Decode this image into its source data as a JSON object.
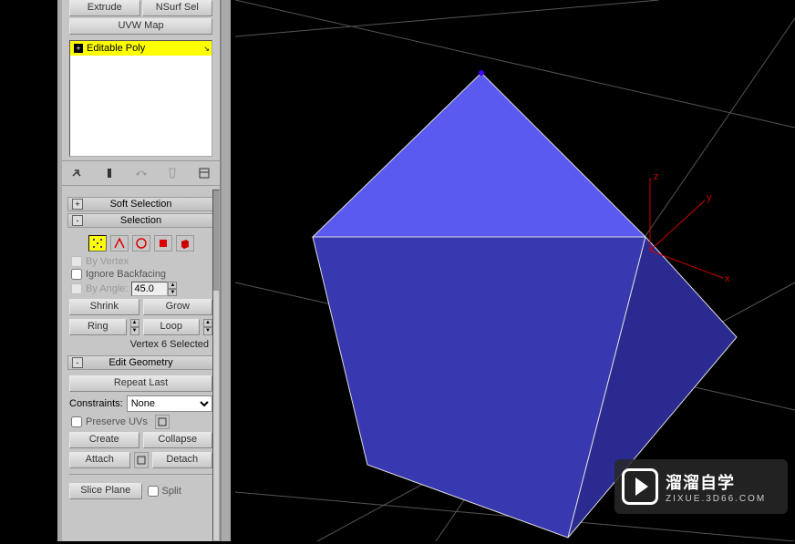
{
  "top_buttons": {
    "extrude": "Extrude",
    "nsurf": "NSurf Sel",
    "uvw": "UVW Map"
  },
  "modifier": {
    "item": "Editable Poly"
  },
  "rollouts": {
    "soft_selection": "Soft Selection",
    "selection": "Selection",
    "edit_geometry": "Edit Geometry"
  },
  "selection": {
    "by_vertex": "By Vertex",
    "ignore_backfacing": "Ignore Backfacing",
    "by_angle": "By Angle:",
    "angle_value": "45.0",
    "shrink": "Shrink",
    "grow": "Grow",
    "ring": "Ring",
    "loop": "Loop",
    "status": "Vertex 6 Selected"
  },
  "edit_geom": {
    "repeat_last": "Repeat Last",
    "constraints_label": "Constraints:",
    "constraints_value": "None",
    "preserve_uvs": "Preserve UVs",
    "create": "Create",
    "collapse": "Collapse",
    "attach": "Attach",
    "detach": "Detach",
    "slice_plane": "Slice Plane",
    "split": "Split"
  },
  "axes": {
    "x": "x",
    "y": "y",
    "z": "z"
  },
  "watermark": {
    "main": "溜溜自学",
    "sub": "ZIXUE.3D66.COM"
  }
}
